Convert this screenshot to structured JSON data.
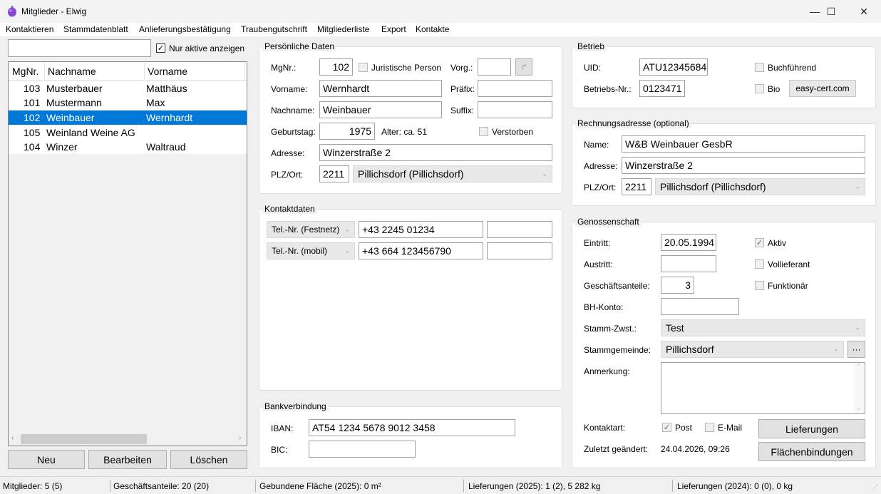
{
  "window": {
    "title": "Mitglieder - Elwig",
    "minimize": "—",
    "maximize": "☐",
    "close": "✕"
  },
  "menu": [
    "Kontaktieren",
    "Stammdatenblatt",
    "Anlieferungsbestätigung",
    "Traubengutschrift",
    "Mitgliederliste",
    "Export",
    "Kontakte"
  ],
  "search": {
    "value": "",
    "active_only_label": "Nur aktive anzeigen",
    "active_only_checked": true
  },
  "list": {
    "columns": [
      "MgNr.",
      "Nachname",
      "Vorname"
    ],
    "rows": [
      {
        "mgnr": "103",
        "nachname": "Musterbauer",
        "vorname": "Matthäus",
        "selected": false
      },
      {
        "mgnr": "101",
        "nachname": "Mustermann",
        "vorname": "Max",
        "selected": false
      },
      {
        "mgnr": "102",
        "nachname": "Weinbauer",
        "vorname": "Wernhardt",
        "selected": true
      },
      {
        "mgnr": "105",
        "nachname": "Weinland Weine AG",
        "vorname": "",
        "selected": false
      },
      {
        "mgnr": "104",
        "nachname": "Winzer",
        "vorname": "Waltraud",
        "selected": false
      }
    ]
  },
  "buttons": {
    "neu": "Neu",
    "bearbeiten": "Bearbeiten",
    "loeschen": "Löschen"
  },
  "personal": {
    "title": "Persönliche Daten",
    "mgnr_label": "MgNr.:",
    "mgnr": "102",
    "juristisch_label": "Juristische Person",
    "vorg_label": "Vorg.:",
    "vorg": "",
    "vorname_label": "Vorname:",
    "vorname": "Wernhardt",
    "praefix_label": "Präfix:",
    "praefix": "",
    "nachname_label": "Nachname:",
    "nachname": "Weinbauer",
    "suffix_label": "Suffix:",
    "suffix": "",
    "geburtstag_label": "Geburtstag:",
    "geburtstag": "1975",
    "alter": "Alter: ca. 51",
    "verstorben_label": "Verstorben",
    "adresse_label": "Adresse:",
    "adresse": "Winzerstraße 2",
    "plz_label": "PLZ/Ort:",
    "plz": "2211",
    "ort": "Pillichsdorf (Pillichsdorf)"
  },
  "kontakt": {
    "title": "Kontaktdaten",
    "phones": [
      {
        "type": "Tel.-Nr. (Festnetz)",
        "number": "+43 2245 01234",
        "note": ""
      },
      {
        "type": "Tel.-Nr. (mobil)",
        "number": "+43 664 123456790",
        "note": ""
      }
    ]
  },
  "bank": {
    "title": "Bankverbindung",
    "iban_label": "IBAN:",
    "iban": "AT54 1234 5678 9012 3458",
    "bic_label": "BIC:",
    "bic": ""
  },
  "betrieb": {
    "title": "Betrieb",
    "uid_label": "UID:",
    "uid": "ATU12345684",
    "betriebsnr_label": "Betriebs-Nr.:",
    "betriebsnr": "0123471",
    "buchfuehrend_label": "Buchführend",
    "bio_label": "Bio",
    "easycert_label": "easy-cert.com"
  },
  "rechnung": {
    "title": "Rechnungsadresse (optional)",
    "name_label": "Name:",
    "name": "W&B Weinbauer GesbR",
    "adresse_label": "Adresse:",
    "adresse": "Winzerstraße 2",
    "plz_label": "PLZ/Ort:",
    "plz": "2211",
    "ort": "Pillichsdorf (Pillichsdorf)"
  },
  "genossenschaft": {
    "title": "Genossenschaft",
    "eintritt_label": "Eintritt:",
    "eintritt": "20.05.1994",
    "austritt_label": "Austritt:",
    "austritt": "",
    "anteile_label": "Geschäftsanteile:",
    "anteile": "3",
    "bhkonto_label": "BH-Konto:",
    "bhkonto": "",
    "zwst_label": "Stamm-Zwst.:",
    "zwst": "Test",
    "gemeinde_label": "Stammgemeinde:",
    "gemeinde": "Pillichsdorf",
    "more_label": "···",
    "anmerkung_label": "Anmerkung:",
    "anmerkung": "",
    "aktiv_label": "Aktiv",
    "volllieferant_label": "Vollieferant",
    "funktionaer_label": "Funktionär",
    "kontaktart_label": "Kontaktart:",
    "post_label": "Post",
    "email_label": "E-Mail",
    "geaendert_label": "Zuletzt geändert:",
    "geaendert": "24.04.2026, 09:26",
    "lieferungen_btn": "Lieferungen",
    "flaechen_btn": "Flächenbindungen"
  },
  "status": {
    "mitglieder": "Mitglieder: 5 (5)",
    "anteile": "Geschäftsanteile: 20 (20)",
    "flaeche": "Gebundene Fläche (2025): 0 m²",
    "lieferungen_2025": "Lieferungen (2025): 1 (2), 5 282 kg",
    "lieferungen_2024": "Lieferungen (2024): 0 (0), 0 kg"
  }
}
